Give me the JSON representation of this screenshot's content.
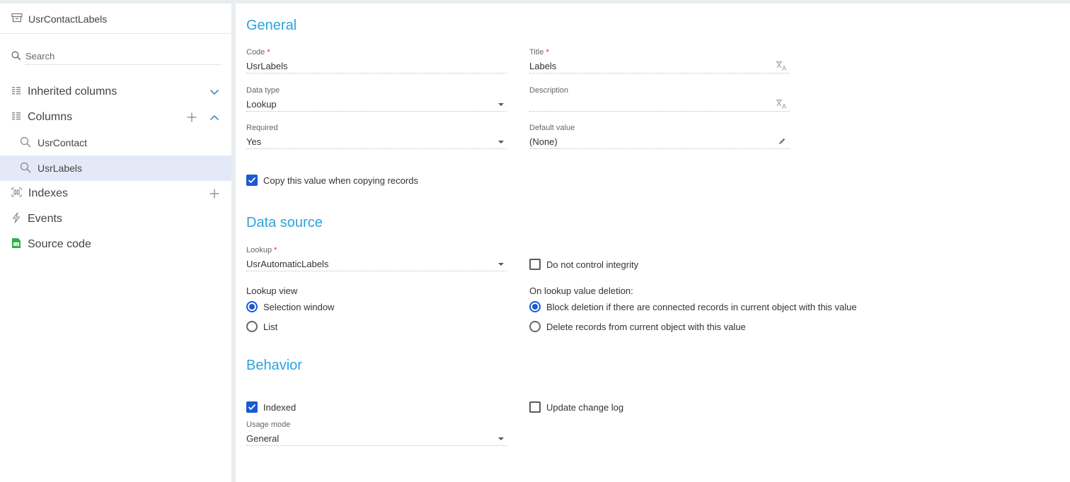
{
  "sidebar": {
    "object_title": "UsrContactLabels",
    "search_placeholder": "Search",
    "inherited_columns": "Inherited columns",
    "columns": "Columns",
    "column_items": [
      "UsrContact",
      "UsrLabels"
    ],
    "indexes": "Indexes",
    "events": "Events",
    "source_code": "Source code"
  },
  "general": {
    "title": "General",
    "code_label": "Code",
    "code_value": "UsrLabels",
    "title_label": "Title",
    "title_value": "Labels",
    "data_type_label": "Data type",
    "data_type_value": "Lookup",
    "description_label": "Description",
    "description_value": "",
    "required_label": "Required",
    "required_value": "Yes",
    "default_value_label": "Default value",
    "default_value_value": "(None)",
    "copy_value_label": "Copy this value when copying records",
    "copy_value_checked": true
  },
  "data_source": {
    "title": "Data source",
    "lookup_label": "Lookup",
    "lookup_value": "UsrAutomaticLabels",
    "no_integrity_label": "Do not control integrity",
    "no_integrity_checked": false,
    "lookup_view_label": "Lookup view",
    "lookup_view_options": [
      "Selection window",
      "List"
    ],
    "lookup_view_selected": "Selection window",
    "deletion_label": "On lookup value deletion:",
    "deletion_options": [
      "Block deletion if there are connected records in current object with this value",
      "Delete records from current object with this value"
    ],
    "deletion_selected": "Block deletion if there are connected records in current object with this value"
  },
  "behavior": {
    "title": "Behavior",
    "indexed_label": "Indexed",
    "indexed_checked": true,
    "change_log_label": "Update change log",
    "change_log_checked": false,
    "usage_mode_label": "Usage mode",
    "usage_mode_value": "General"
  },
  "required_mark": "*",
  "colors": {
    "accent": "#2ea3dd",
    "primary": "#1a5bd1",
    "selected_bg": "#e3e9f7",
    "required": "#d9262c"
  }
}
